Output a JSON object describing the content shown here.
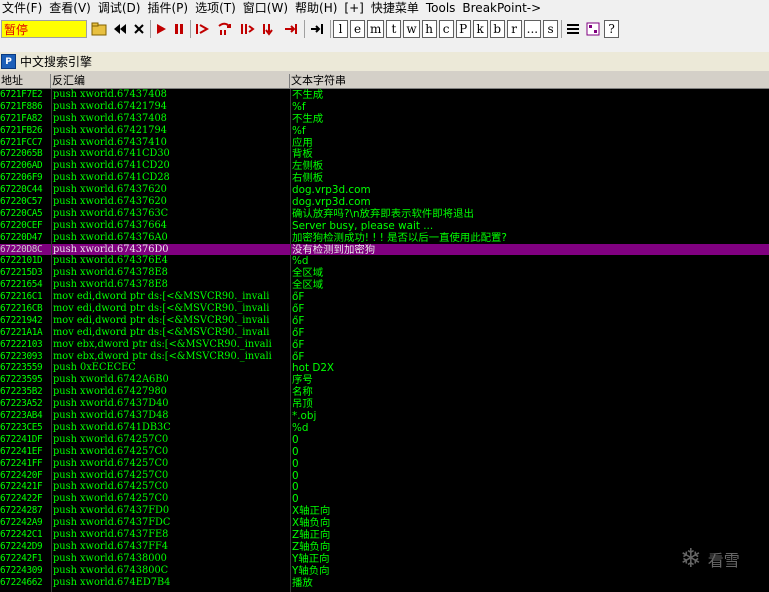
{
  "menubar": {
    "items": [
      "文件(F)",
      "查看(V)",
      "调试(D)",
      "插件(P)",
      "选项(T)",
      "窗口(W)",
      "帮助(H)",
      "[+]",
      "快捷菜单",
      "Tools",
      "BreakPoint->"
    ]
  },
  "toolbar": {
    "status": "暂停",
    "letters": [
      "l",
      "e",
      "m",
      "t",
      "w",
      "h",
      "c",
      "P",
      "k",
      "b",
      "r",
      "...",
      "s"
    ],
    "help": "?"
  },
  "window": {
    "icon": "P",
    "title": "中文搜索引擎"
  },
  "columns": {
    "address": "地址",
    "disassembly": "反汇编",
    "text": "文本字符串"
  },
  "rows": [
    {
      "a": "6721F7E2",
      "d": "push xworld.67437408",
      "t": "不生成"
    },
    {
      "a": "6721F886",
      "d": "push xworld.67421794",
      "t": "%f"
    },
    {
      "a": "6721FA82",
      "d": "push xworld.67437408",
      "t": "不生成"
    },
    {
      "a": "6721FB26",
      "d": "push xworld.67421794",
      "t": "%f"
    },
    {
      "a": "6721FCC7",
      "d": "push xworld.67437410",
      "t": "应用"
    },
    {
      "a": "6722065B",
      "d": "push xworld.6741CD30",
      "t": "背板"
    },
    {
      "a": "672206AD",
      "d": "push xworld.6741CD20",
      "t": "左侧板"
    },
    {
      "a": "672206F9",
      "d": "push xworld.6741CD28",
      "t": "右侧板"
    },
    {
      "a": "67220C44",
      "d": "push xworld.67437620",
      "t": "dog.vrp3d.com"
    },
    {
      "a": "67220C57",
      "d": "push xworld.67437620",
      "t": "dog.vrp3d.com"
    },
    {
      "a": "67220CA5",
      "d": "push xworld.6743763C",
      "t": "确认放弃吗?\\n放弃即表示软件即将退出"
    },
    {
      "a": "67220CEF",
      "d": "push xworld.67437664",
      "t": "Server busy, please wait ..."
    },
    {
      "a": "67220D47",
      "d": "push xworld.674376A0",
      "t": "加密狗检测成功! ! ! 是否以后一直使用此配置?"
    },
    {
      "a": "67220D8C",
      "d": "push xworld.674376D0",
      "t": "没有检测到加密狗",
      "selected": true
    },
    {
      "a": "6722101D",
      "d": "push xworld.674376E4",
      "t": "%d"
    },
    {
      "a": "672215D3",
      "d": "push xworld.674378E8",
      "t": "全区域"
    },
    {
      "a": "67221654",
      "d": "push xworld.674378E8",
      "t": "全区域"
    },
    {
      "a": "672216C1",
      "d": "mov edi,dword ptr ds:[<&MSVCR90._invali",
      "t": "őF"
    },
    {
      "a": "672216CB",
      "d": "mov edi,dword ptr ds:[<&MSVCR90._invali",
      "t": "őF"
    },
    {
      "a": "67221942",
      "d": "mov edi,dword ptr ds:[<&MSVCR90._invali",
      "t": "őF"
    },
    {
      "a": "67221A1A",
      "d": "mov edi,dword ptr ds:[<&MSVCR90._invali",
      "t": "őF"
    },
    {
      "a": "67222103",
      "d": "mov ebx,dword ptr ds:[<&MSVCR90._invali",
      "t": "őF"
    },
    {
      "a": "67223093",
      "d": "mov ebx,dword ptr ds:[<&MSVCR90._invali",
      "t": "őF"
    },
    {
      "a": "67223559",
      "d": "push 0xECECEC",
      "t": "hot D2X"
    },
    {
      "a": "67223595",
      "d": "push xworld.6742A6B0",
      "t": "序号"
    },
    {
      "a": "672235B2",
      "d": "push xworld.67427980",
      "t": "名称"
    },
    {
      "a": "67223A52",
      "d": "push xworld.67437D40",
      "t": "吊顶"
    },
    {
      "a": "67223AB4",
      "d": "push xworld.67437D48",
      "t": "*.obj"
    },
    {
      "a": "67223CE5",
      "d": "push xworld.6741DB3C",
      "t": "%d"
    },
    {
      "a": "672241DF",
      "d": "push xworld.674257C0",
      "t": "0"
    },
    {
      "a": "672241EF",
      "d": "push xworld.674257C0",
      "t": "0"
    },
    {
      "a": "672241FF",
      "d": "push xworld.674257C0",
      "t": "0"
    },
    {
      "a": "6722420F",
      "d": "push xworld.674257C0",
      "t": "0"
    },
    {
      "a": "6722421F",
      "d": "push xworld.674257C0",
      "t": "0"
    },
    {
      "a": "6722422F",
      "d": "push xworld.674257C0",
      "t": "0"
    },
    {
      "a": "67224287",
      "d": "push xworld.67437FD0",
      "t": "X轴正向"
    },
    {
      "a": "672242A9",
      "d": "push xworld.67437FDC",
      "t": "X轴负向"
    },
    {
      "a": "672242C1",
      "d": "push xworld.67437FE8",
      "t": "Z轴正向"
    },
    {
      "a": "672242D9",
      "d": "push xworld.67437FF4",
      "t": "Z轴负向"
    },
    {
      "a": "672242F1",
      "d": "push xworld.67438000",
      "t": "Y轴正向"
    },
    {
      "a": "67224309",
      "d": "push xworld.6743800C",
      "t": "Y轴负向"
    },
    {
      "a": "67224662",
      "d": "push xworld.674ED7B4",
      "t": "播放"
    }
  ],
  "watermark": {
    "text": "看雪"
  }
}
